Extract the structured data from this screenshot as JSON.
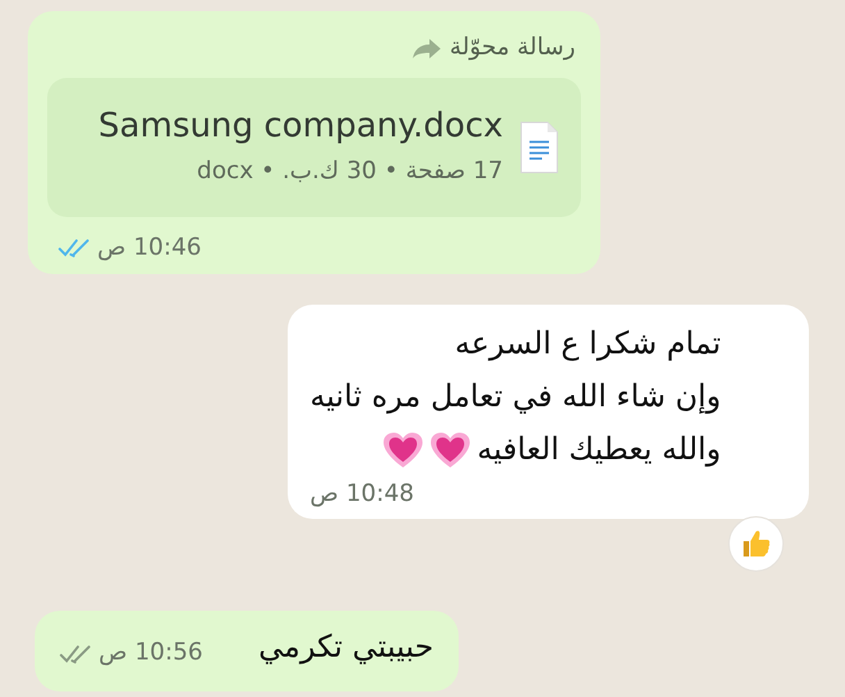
{
  "messages": [
    {
      "kind": "document",
      "forwarded_label": "رسالة محوّلة",
      "file_name": "Samsung company.docx",
      "file_meta": "17 صفحة • 30 ك.ب. • docx",
      "time": "10:46 ص",
      "read": true,
      "outgoing": true
    },
    {
      "kind": "text",
      "lines": [
        {
          "text": "تمام شكرا ع السرعه",
          "hearts": false
        },
        {
          "text": "وإن شاء الله في تعامل مره ثانيه",
          "hearts": false
        },
        {
          "text": "والله يعطيك العافيه",
          "hearts": true
        }
      ],
      "time": "10:48 ص",
      "reacted": true,
      "outgoing": false
    },
    {
      "kind": "text",
      "lines": [
        {
          "text": "حبيبتي تكرمي",
          "hearts": false
        }
      ],
      "time": "10:56 ص",
      "read": false,
      "outgoing": true
    }
  ]
}
